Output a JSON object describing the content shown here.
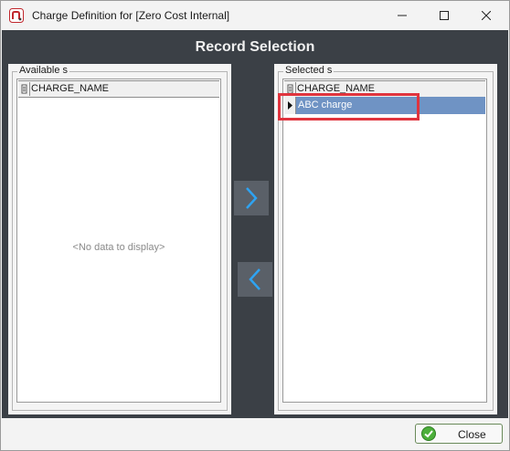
{
  "window": {
    "title": "Charge Definition for [Zero Cost Internal]"
  },
  "page": {
    "heading": "Record Selection"
  },
  "available": {
    "group_title": "Available s",
    "column_header": "CHARGE_NAME",
    "empty_text": "<No data to display>"
  },
  "selected": {
    "group_title": "Selected s",
    "column_header": "CHARGE_NAME",
    "rows": [
      "ABC charge"
    ]
  },
  "footer": {
    "close_label": "Close"
  },
  "colors": {
    "content_bg": "#3b4046",
    "selected_row": "#6f93c4",
    "arrow": "#2ea3f2",
    "highlight": "#e0343e"
  },
  "icons": {
    "app": "app-logo-icon",
    "minimize": "minimize-icon",
    "maximize": "maximize-icon",
    "close": "window-close-icon",
    "move_right": "chevron-right-icon",
    "move_left": "chevron-left-icon",
    "row_pointer": "row-pointer-icon",
    "ok": "green-check-icon"
  }
}
